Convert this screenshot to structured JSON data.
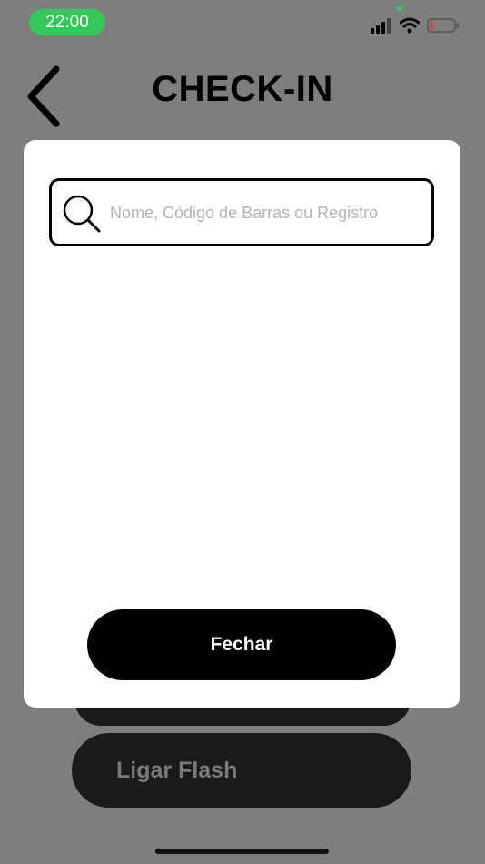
{
  "status_bar": {
    "time": "22:00",
    "icons": [
      "cellular-signal-icon",
      "wifi-icon",
      "battery-low-icon"
    ],
    "time_pill_color": "#35c759",
    "battery_level": 0.1
  },
  "header": {
    "title": "CHECK-IN",
    "back_icon": "chevron-left-icon"
  },
  "modal": {
    "search": {
      "icon": "search-icon",
      "placeholder": "Nome, Código de Barras ou Registro",
      "value": ""
    },
    "close_label": "Fechar"
  },
  "background_actions": {
    "flash_label": "Ligar Flash"
  },
  "colors": {
    "backdrop": "#7e7e7e",
    "primary_button": "#000000",
    "secondary_button": "#1a1a1a"
  }
}
